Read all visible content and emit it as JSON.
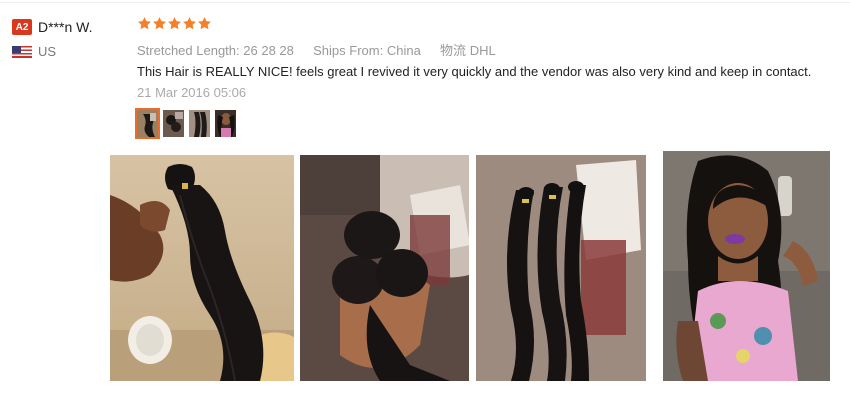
{
  "buyer": {
    "level_badge": "A2",
    "name": "D***n W.",
    "country": "US",
    "flag_icon": "us-flag-icon"
  },
  "review": {
    "rating_stars": 5,
    "star_color": "#f4802a",
    "specs": [
      {
        "label": "Stretched Length:",
        "value": "26 28 28"
      },
      {
        "label": "Ships From:",
        "value": "China"
      },
      {
        "label": "物流",
        "value": "DHL"
      }
    ],
    "text": "This Hair is REALLY NICE! feels great I revived it very quickly and the vendor was also very kind and keep in contact.",
    "date": "21 Mar 2016 05:06"
  },
  "thumbnails": {
    "count": 4,
    "active_index": 0,
    "active_border_color": "#e96e2b"
  },
  "photos": [
    {
      "name": "photo-hair-bundle-in-hand"
    },
    {
      "name": "photo-rolled-bundles-in-hand"
    },
    {
      "name": "photo-bundles-on-bed"
    },
    {
      "name": "photo-model-wearing-hair"
    }
  ]
}
